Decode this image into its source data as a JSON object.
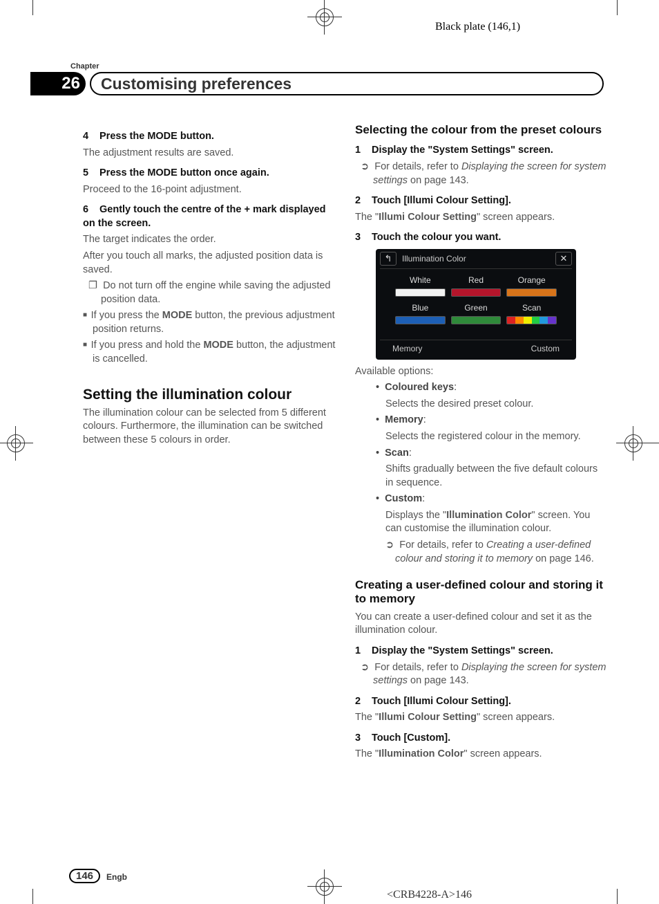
{
  "header_plate": "Black plate (146,1)",
  "chapter_label": "Chapter",
  "chapter_number": "26",
  "chapter_title": "Customising preferences",
  "left_column": {
    "step4": {
      "num": "4",
      "title": "Press the MODE button.",
      "body": "The adjustment results are saved."
    },
    "step5": {
      "num": "5",
      "title": "Press the MODE button once again.",
      "body": "Proceed to the 16-point adjustment."
    },
    "step6": {
      "num": "6",
      "title": "Gently touch the centre of the + mark displayed on the screen.",
      "body1": "The target indicates the order.",
      "body2": "After you touch all marks, the adjusted position data is saved.",
      "note1": "Do not turn off the engine while saving the adjusted position data.",
      "bullet1a": "If you press the ",
      "bullet1b": "MODE",
      "bullet1c": " button, the previous adjustment position returns.",
      "bullet2a": "If you press and hold the ",
      "bullet2b": "MODE",
      "bullet2c": " button, the adjustment is cancelled."
    },
    "h2": "Setting the illumination colour",
    "h2_body": "The illumination colour can be selected from 5 different colours. Furthermore, the illumination can be switched between these 5 colours in order."
  },
  "right_column": {
    "h3a": "Selecting the colour from the preset colours",
    "a_step1": {
      "num": "1",
      "title": "Display the \"System Settings\" screen.",
      "ref_lead": "For details, refer to ",
      "ref_ital": "Displaying the screen for system settings",
      "ref_tail": " on page 143."
    },
    "a_step2": {
      "num": "2",
      "title": "Touch [Illumi Colour Setting].",
      "body_pre": "The \"",
      "body_bold": "Illumi Colour Setting",
      "body_post": "\" screen appears."
    },
    "a_step3": {
      "num": "3",
      "title": "Touch the colour you want."
    },
    "screenshot": {
      "title": "Illumination Color",
      "colors": [
        {
          "label": "White",
          "hex": "#f2f2f2"
        },
        {
          "label": "Red",
          "hex": "#b5152b"
        },
        {
          "label": "Orange",
          "hex": "#d8741a"
        },
        {
          "label": "Blue",
          "hex": "#1d5fb5"
        },
        {
          "label": "Green",
          "hex": "#2f8a3a"
        },
        {
          "label": "Scan",
          "hex": "scan"
        }
      ],
      "scan_colors": [
        "#d22",
        "#f80",
        "#ee0",
        "#2c4",
        "#29d",
        "#63c"
      ],
      "bottom_left": "Memory",
      "bottom_right": "Custom"
    },
    "avail_label": "Available options:",
    "opts": {
      "o1": {
        "name": "Coloured keys",
        "desc": "Selects the desired preset colour."
      },
      "o2": {
        "name": "Memory",
        "desc": "Selects the registered colour in the memory."
      },
      "o3": {
        "name": "Scan",
        "desc": "Shifts gradually between the five default colours in sequence."
      },
      "o4": {
        "name": "Custom",
        "desc_pre": "Displays the \"",
        "desc_bold": "Illumination Color",
        "desc_post": "\" screen. You can customise the illumination colour.",
        "ref_lead": "For details, refer to ",
        "ref_ital": "Creating a user-defined colour and storing it to memory",
        "ref_tail": " on page 146."
      }
    },
    "h3b": "Creating a user-defined colour and storing it to memory",
    "h3b_body": "You can create a user-defined colour and set it as the illumination colour.",
    "b_step1": {
      "num": "1",
      "title": "Display the \"System Settings\" screen.",
      "ref_lead": "For details, refer to ",
      "ref_ital": "Displaying the screen for system settings",
      "ref_tail": " on page 143."
    },
    "b_step2": {
      "num": "2",
      "title": "Touch [Illumi Colour Setting].",
      "body_pre": "The \"",
      "body_bold": "Illumi Colour Setting",
      "body_post": "\" screen appears."
    },
    "b_step3": {
      "num": "3",
      "title": "Touch [Custom].",
      "body_pre": "The \"",
      "body_bold": "Illumination Color",
      "body_post": "\" screen appears."
    }
  },
  "page_number": "146",
  "lang_code": "Engb",
  "footer_code": "<CRB4228-A>146"
}
